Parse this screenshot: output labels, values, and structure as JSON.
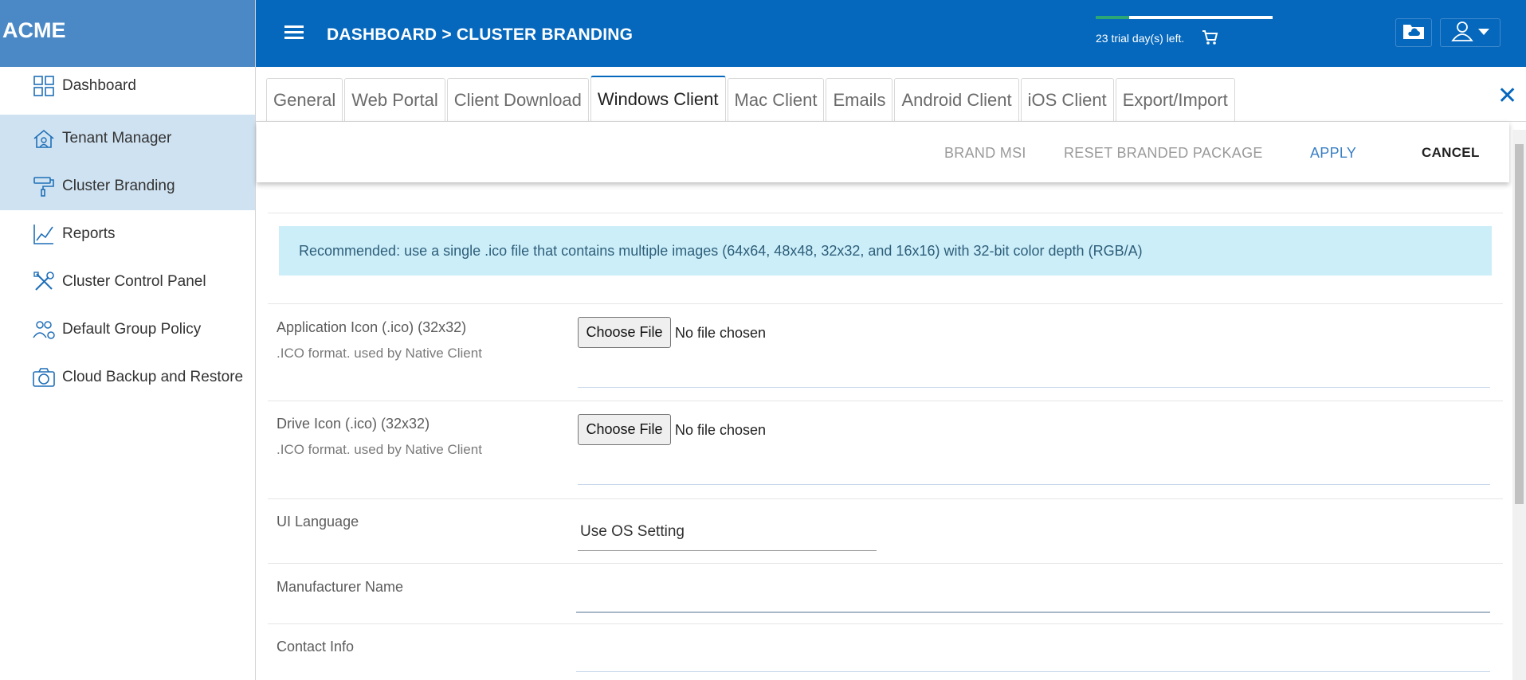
{
  "sidebar": {
    "brand": "ACME",
    "items": [
      {
        "label": "Dashboard",
        "icon": "dashboard-grid-icon"
      },
      {
        "label": "Tenant Manager",
        "icon": "tenant-house-icon"
      },
      {
        "label": "Cluster Branding",
        "icon": "paint-roller-icon"
      },
      {
        "label": "Reports",
        "icon": "line-chart-icon"
      },
      {
        "label": "Cluster Control Panel",
        "icon": "tools-icon"
      },
      {
        "label": "Default Group Policy",
        "icon": "group-settings-icon"
      },
      {
        "label": "Cloud Backup and Restore",
        "icon": "camera-icon"
      }
    ]
  },
  "header": {
    "breadcrumb": "DASHBOARD > CLUSTER BRANDING",
    "trial_text": "23 trial day(s) left.",
    "trial_progress": 0.19
  },
  "tabs": [
    {
      "label": "General",
      "active": false
    },
    {
      "label": "Web Portal",
      "active": false
    },
    {
      "label": "Client Download",
      "active": false
    },
    {
      "label": "Windows Client",
      "active": true
    },
    {
      "label": "Mac Client",
      "active": false
    },
    {
      "label": "Emails",
      "active": false
    },
    {
      "label": "Android Client",
      "active": false
    },
    {
      "label": "iOS Client",
      "active": false
    },
    {
      "label": "Export/Import",
      "active": false
    }
  ],
  "actions": {
    "brand_msi": "BRAND MSI",
    "reset": "RESET BRANDED PACKAGE",
    "apply": "APPLY",
    "cancel": "CANCEL"
  },
  "info": {
    "text": "Recommended: use a single .ico file that contains multiple images (64x64, 48x48, 32x32, and 16x16) with 32-bit color depth (RGB/A)"
  },
  "form": {
    "app_icon": {
      "label": "Application Icon (.ico) (32x32)",
      "sub": ".ICO format. used by Native Client",
      "button": "Choose File",
      "status": "No file chosen"
    },
    "drive_icon": {
      "label": "Drive Icon (.ico) (32x32)",
      "sub": ".ICO format. used by Native Client",
      "button": "Choose File",
      "status": "No file chosen"
    },
    "ui_language": {
      "label": "UI Language",
      "value": "Use OS Setting"
    },
    "manufacturer": {
      "label": "Manufacturer Name",
      "value": ""
    },
    "contact": {
      "label": "Contact Info",
      "value": ""
    }
  },
  "colors": {
    "header": "#0568bd",
    "brand_bg": "#4a89c6",
    "active_nav_bg": "#cfe2f1",
    "info_bg": "#cceef9",
    "apply": "#3a7fc4"
  }
}
